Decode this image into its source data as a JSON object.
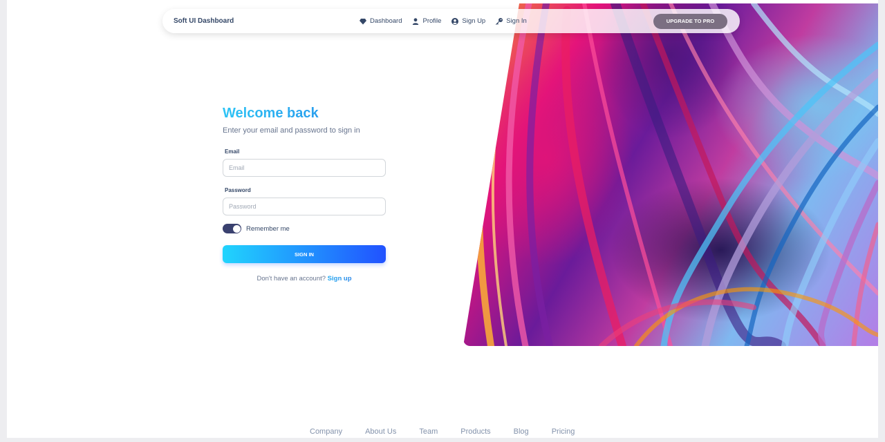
{
  "navbar": {
    "brand": "Soft UI Dashboard",
    "links": [
      {
        "label": "Dashboard",
        "icon": "diamond-icon"
      },
      {
        "label": "Profile",
        "icon": "user-icon"
      },
      {
        "label": "Sign Up",
        "icon": "user-circle-icon"
      },
      {
        "label": "Sign In",
        "icon": "key-icon"
      }
    ],
    "upgrade_label": "UPGRADE TO PRO"
  },
  "form": {
    "title": "Welcome back",
    "subtitle": "Enter your email and password to sign in",
    "email_label": "Email",
    "email_placeholder": "Email",
    "password_label": "Password",
    "password_placeholder": "Password",
    "remember_label": "Remember me",
    "remember_checked": true,
    "signin_label": "SIGN IN",
    "no_account_text": "Don't have an account?",
    "signup_link": "Sign up"
  },
  "footer": {
    "links": [
      "Company",
      "About Us",
      "Team",
      "Products",
      "Blog",
      "Pricing"
    ]
  },
  "colors": {
    "accent_start": "#21d4fd",
    "accent_end": "#2152ff",
    "title": "#21a0f2",
    "dark": "#344767",
    "muted": "#67748e",
    "upgrade_button": "#7b6f82",
    "toggle_on": "#3a416f"
  }
}
